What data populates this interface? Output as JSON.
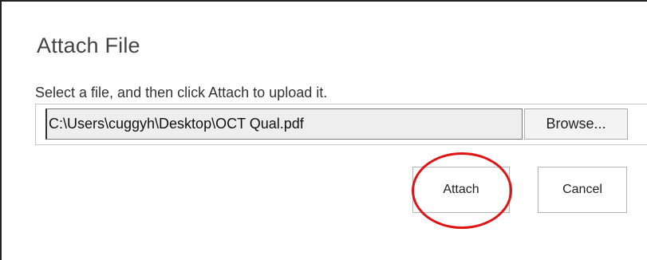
{
  "dialog": {
    "title": "Attach File",
    "instruction": "Select a file, and then click Attach to upload it.",
    "file_path": "C:\\Users\\cuggyh\\Desktop\\OCT Qual.pdf",
    "browse_label": "Browse...",
    "attach_label": "Attach",
    "cancel_label": "Cancel"
  },
  "colors": {
    "highlight": "#e01414",
    "input_background": "#eeeeee"
  }
}
